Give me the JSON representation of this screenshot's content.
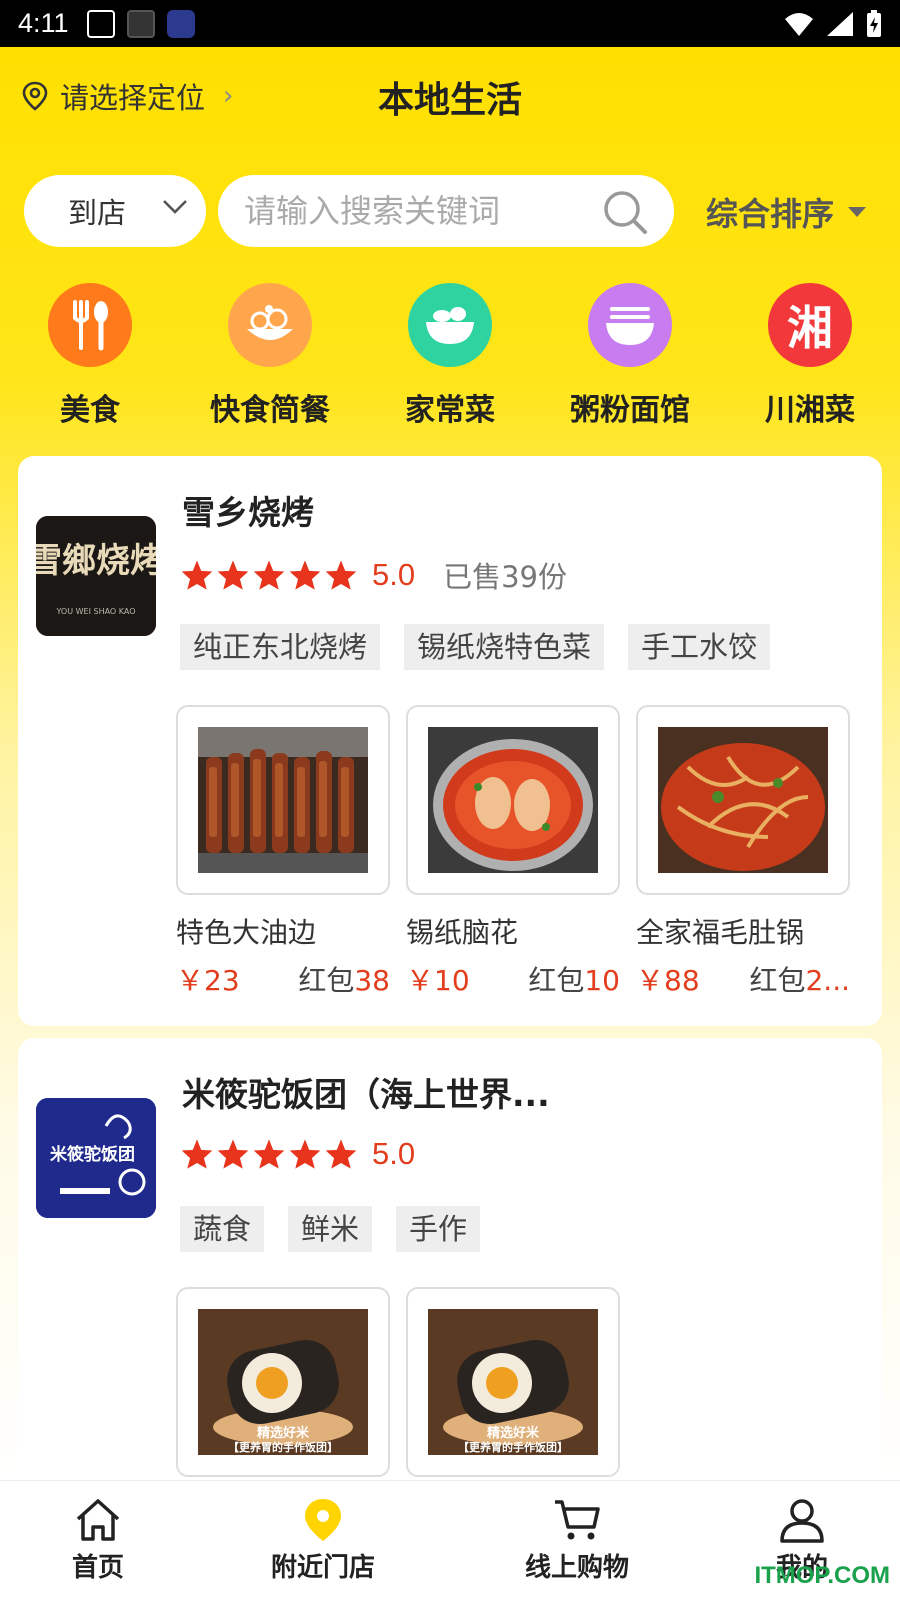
{
  "status_bar": {
    "time": "4:11"
  },
  "header": {
    "location_text": "请选择定位",
    "title": "本地生活"
  },
  "search": {
    "store_mode": "到店",
    "placeholder": "请输入搜索关键词",
    "sort_label": "综合排序"
  },
  "categories": [
    {
      "label": "美食",
      "color": "#ff7a1a",
      "icon": "fork-spoon-icon"
    },
    {
      "label": "快食简餐",
      "color": "#ffa64d",
      "icon": "snack-plate-icon"
    },
    {
      "label": "家常菜",
      "color": "#2fd3a0",
      "icon": "salad-bowl-icon"
    },
    {
      "label": "粥粉面馆",
      "color": "#c77cf0",
      "icon": "noodle-bowl-icon"
    },
    {
      "label": "川湘菜",
      "color": "#f2383a",
      "icon": "xiang-char-icon",
      "glyph": "湘"
    }
  ],
  "shops": [
    {
      "name": "雪乡烧烤",
      "logo_text": "雪鄉烧烤",
      "logo_sub": "YOU WEI SHAO KAO",
      "rating": "5.0",
      "sold": "已售39份",
      "tags": [
        "纯正东北烧烤",
        "锡纸烧特色菜",
        "手工水饺"
      ],
      "products": [
        {
          "name": "特色大油边",
          "price": "￥23",
          "redpack_label": "红包",
          "redpack_value": "38"
        },
        {
          "name": "锡纸脑花",
          "price": "￥10",
          "redpack_label": "红包",
          "redpack_value": "10"
        },
        {
          "name": "全家福毛肚锅",
          "price": "￥88",
          "redpack_label": "红包",
          "redpack_value": "2..."
        }
      ]
    },
    {
      "name": "米筱驼饭团（海上世界...",
      "logo_text": "米筱驼饭团",
      "rating": "5.0",
      "tags": [
        "蔬食",
        "鲜米",
        "手作"
      ],
      "products": [
        {
          "caption": "精选好米",
          "subcaption": "【更养胃的手作饭团】"
        },
        {
          "caption": "精选好米",
          "subcaption": "【更养胃的手作饭团】"
        }
      ]
    }
  ],
  "tabbar": [
    {
      "label": "首页",
      "icon": "home-icon"
    },
    {
      "label": "附近门店",
      "icon": "location-pin-icon",
      "active": true
    },
    {
      "label": "线上购物",
      "icon": "cart-icon"
    },
    {
      "label": "我的",
      "icon": "user-icon"
    }
  ],
  "watermark": "ITMOP.COM"
}
